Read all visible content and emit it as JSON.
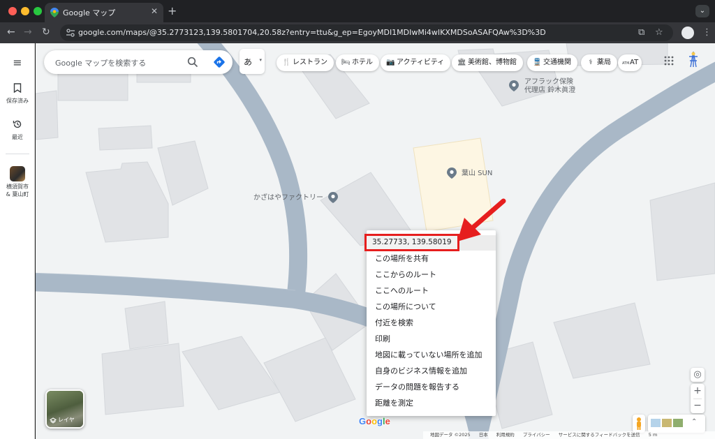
{
  "browser": {
    "tab_title": "Google マップ",
    "tab_close": "✕",
    "new_tab": "+",
    "tab_menu": "⌄",
    "url": "google.com/maps/@35.2773123,139.5801704,20.58z?entry=ttu&g_ep=EgoyMDI1MDIwMi4wIKXMDSoASAFQAw%3D%3D",
    "nav": {
      "back": "←",
      "forward": "→",
      "reload": "↻"
    },
    "omni_right": {
      "install": "⧉",
      "bookmark": "☆"
    },
    "kebab": "⋮"
  },
  "rail": {
    "menu_icon": "≡",
    "saved": "保存済み",
    "recent": "最近",
    "recent_place_line1": "横須賀市",
    "recent_place_line2": "& 葉山町"
  },
  "search": {
    "placeholder": "Google マップを検索する",
    "ime": "あ",
    "ime_caret": "▾"
  },
  "chips": [
    {
      "icon": "fork-knife-icon",
      "glyph": "🍴",
      "label": "レストラン"
    },
    {
      "icon": "bed-icon",
      "glyph": "🛏",
      "label": "ホテル"
    },
    {
      "icon": "camera-icon",
      "glyph": "📷",
      "label": "アクティビティ"
    },
    {
      "icon": "museum-icon",
      "glyph": "🏛",
      "label": "美術館、博物館"
    },
    {
      "icon": "transit-icon",
      "glyph": "🚆",
      "label": "交通機関"
    },
    {
      "icon": "pharmacy-icon",
      "glyph": "⚕",
      "label": "薬局"
    },
    {
      "icon": "atm-icon",
      "glyph": "ATM",
      "label": "AT"
    }
  ],
  "pois": {
    "aflac_line1": "アフラック保険",
    "aflac_line2": "代理店 鈴木眞澄",
    "hayama_sun": "葉山 SUN",
    "kazahaya": "かざはやファクトリー"
  },
  "context_menu": {
    "coords": "35.27733, 139.58019",
    "items": [
      "この場所を共有",
      "ここからのルート",
      "ここへのルート",
      "この場所について",
      "付近を検索",
      "印刷",
      "地図に載っていない場所を追加",
      "自身のビジネス情報を追加",
      "データの問題を報告する",
      "距離を測定"
    ]
  },
  "controls": {
    "layers_label": "レイヤ",
    "locate": "◎",
    "zoom_in": "+",
    "zoom_out": "−",
    "expand": "⌃"
  },
  "google_logo": [
    "G",
    "o",
    "o",
    "g",
    "l",
    "e"
  ],
  "footer": {
    "map_data": "地図データ ©2025",
    "japan": "日本",
    "terms": "利用規約",
    "privacy": "プライバシー",
    "feedback": "サービスに関するフィードバックを送信",
    "scale": "5 m"
  },
  "colors": {
    "road": "#a9b8c7",
    "building": "#dfe1e5",
    "highlight_building": "#fdf6e3",
    "annotation_red": "#e61e1e",
    "poi_pin": "#6b7b8a"
  }
}
